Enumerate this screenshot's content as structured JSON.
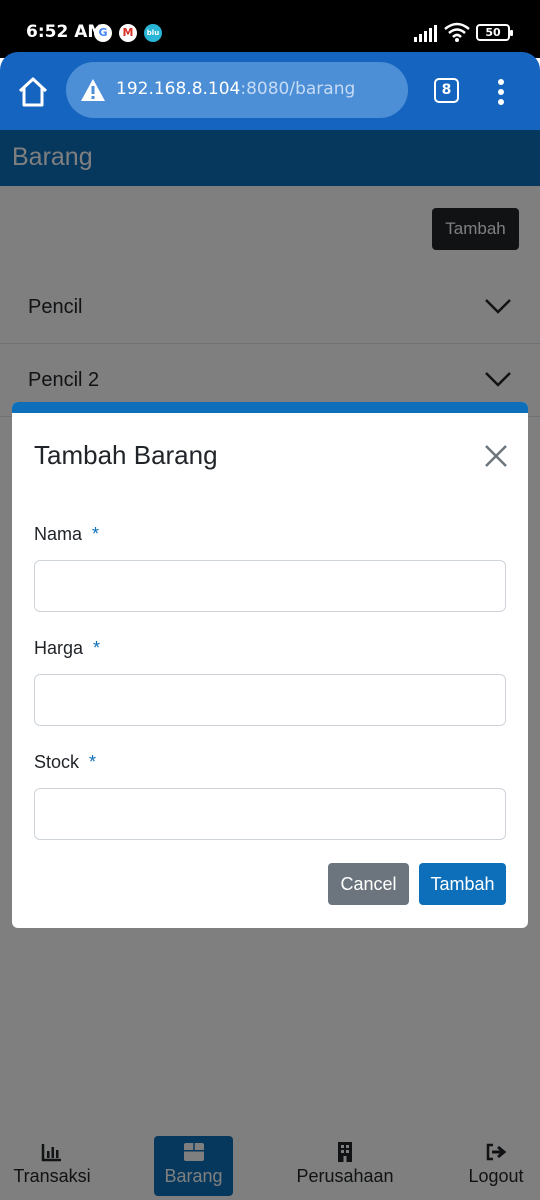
{
  "status_bar": {
    "time": "6:52 AM",
    "notification_icons": [
      "google-icon",
      "gmail-icon",
      "blu-icon"
    ],
    "blu_label": "blu",
    "battery": "50"
  },
  "browser": {
    "url_host": "192.168.8.104",
    "url_rest": ":8080/barang",
    "tab_count": "8"
  },
  "app": {
    "page_title": "Barang",
    "add_button": "Tambah",
    "items": [
      {
        "name": "Pencil"
      },
      {
        "name": "Pencil 2"
      }
    ]
  },
  "modal": {
    "title": "Tambah Barang",
    "fields": [
      {
        "label": "Nama",
        "required": "*",
        "value": "",
        "placeholder": ""
      },
      {
        "label": "Harga",
        "required": "*",
        "value": "",
        "placeholder": ""
      },
      {
        "label": "Stock",
        "required": "*",
        "value": "",
        "placeholder": ""
      }
    ],
    "cancel_label": "Cancel",
    "submit_label": "Tambah"
  },
  "bottom_nav": {
    "items": [
      {
        "label": "Transaksi",
        "icon": "bar-chart-icon"
      },
      {
        "label": "Barang",
        "icon": "box-icon",
        "active": true
      },
      {
        "label": "Perusahaan",
        "icon": "building-icon"
      },
      {
        "label": "Logout",
        "icon": "logout-icon"
      }
    ]
  },
  "colors": {
    "primary": "#0d6fba",
    "browser_bar": "#1565c0",
    "dark_button": "#212529",
    "secondary_button": "#6c757d"
  }
}
